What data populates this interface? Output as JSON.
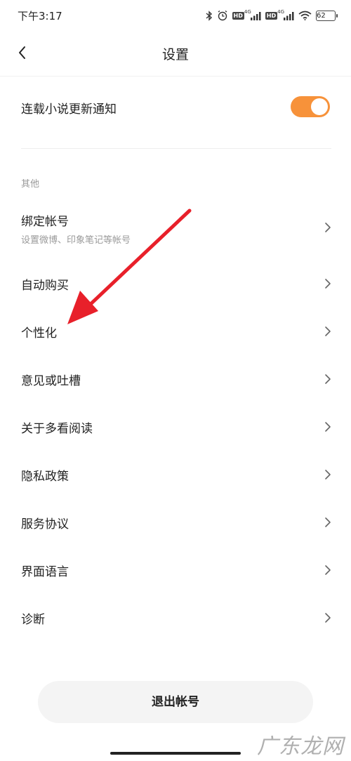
{
  "status_bar": {
    "time": "下午3:17",
    "icons": [
      "bluetooth-icon",
      "alarm-icon",
      "hd-signal-icon",
      "hd-signal-icon",
      "wifi-icon",
      "battery-icon"
    ],
    "hd_label": "HD",
    "network_label": "4G",
    "battery_level": "62"
  },
  "nav": {
    "title": "设置",
    "back_icon": "chevron-left-icon"
  },
  "update_notification": {
    "label": "连载小说更新通知",
    "enabled": true,
    "toggle_color": "#f7923a"
  },
  "section": {
    "header": "其他"
  },
  "items": [
    {
      "label": "绑定帐号",
      "subtitle": "设置微博、印象笔记等帐号"
    },
    {
      "label": "自动购买"
    },
    {
      "label": "个性化"
    },
    {
      "label": "意见或吐槽"
    },
    {
      "label": "关于多看阅读"
    },
    {
      "label": "隐私政策"
    },
    {
      "label": "服务协议"
    },
    {
      "label": "界面语言"
    },
    {
      "label": "诊断"
    }
  ],
  "logout": {
    "label": "退出帐号"
  },
  "annotation": {
    "arrow_color": "#e8202a",
    "target": "个性化"
  },
  "watermark": {
    "text": "广东龙网"
  }
}
